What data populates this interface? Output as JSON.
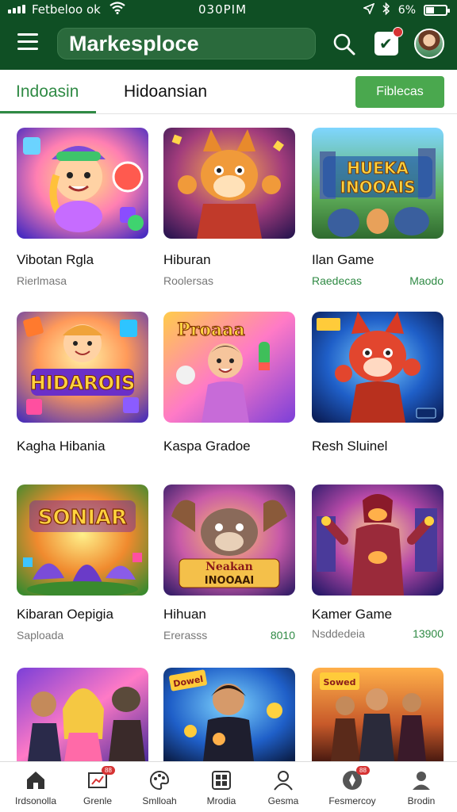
{
  "status": {
    "carrier": "Fetbeloo ok",
    "time": "030PIM",
    "battery": "6%"
  },
  "header": {
    "title": "Markesploce"
  },
  "tabs": {
    "items": [
      {
        "label": "Indoasin",
        "active": true
      },
      {
        "label": "Hidoansian",
        "active": false
      }
    ],
    "action_label": "Fiblecas"
  },
  "cards": [
    {
      "title": "Vibotan Rgla",
      "subtitle": "Rierlmasa",
      "price": ""
    },
    {
      "title": "Hiburan",
      "subtitle": "Roolersas",
      "price": ""
    },
    {
      "title": "Ilan Game",
      "subtitle": "Raedecas",
      "price": "Maodo"
    },
    {
      "title": "Kagha Hibania",
      "subtitle": "",
      "price": ""
    },
    {
      "title": "Kaspa Gradoe",
      "subtitle": "",
      "price": ""
    },
    {
      "title": "Resh Sluinel",
      "subtitle": "",
      "price": ""
    },
    {
      "title": "Kibaran Oepigia",
      "subtitle": "Saploada",
      "price": ""
    },
    {
      "title": "Hihuan",
      "subtitle": "Ererasss",
      "price": "8010"
    },
    {
      "title": "Kamer Game",
      "subtitle": "Nsddedeia",
      "price": "13900"
    },
    {
      "title": "",
      "subtitle": "",
      "price": ""
    },
    {
      "title": "",
      "subtitle": "",
      "price": ""
    },
    {
      "title": "",
      "subtitle": "",
      "price": ""
    }
  ],
  "thumb_text": {
    "t3": [
      "HUEKA",
      "INOOAIS"
    ],
    "t4": "HIDAROIS",
    "t5": "Proaaa",
    "t7": "SONIAR",
    "t8": [
      "Neakan",
      "INOOAAI"
    ],
    "t10": "Dowel",
    "t12": "Sowed"
  },
  "bottom_nav": [
    {
      "label": "Irdsonolla",
      "icon": "home-icon",
      "badge": ""
    },
    {
      "label": "Grenle",
      "icon": "chart-icon",
      "badge": "88"
    },
    {
      "label": "Smlloah",
      "icon": "palette-icon",
      "badge": ""
    },
    {
      "label": "Mrodia",
      "icon": "grid-icon",
      "badge": ""
    },
    {
      "label": "Gesma",
      "icon": "person-icon",
      "badge": ""
    },
    {
      "label": "Fesmercoy",
      "icon": "compass-icon",
      "badge": "88"
    },
    {
      "label": "Brodin",
      "icon": "profile-icon",
      "badge": ""
    }
  ],
  "colors": {
    "brand": "#0f4f24",
    "accent": "#2f8a44",
    "button": "#4aa84e",
    "badge": "#d63333"
  }
}
